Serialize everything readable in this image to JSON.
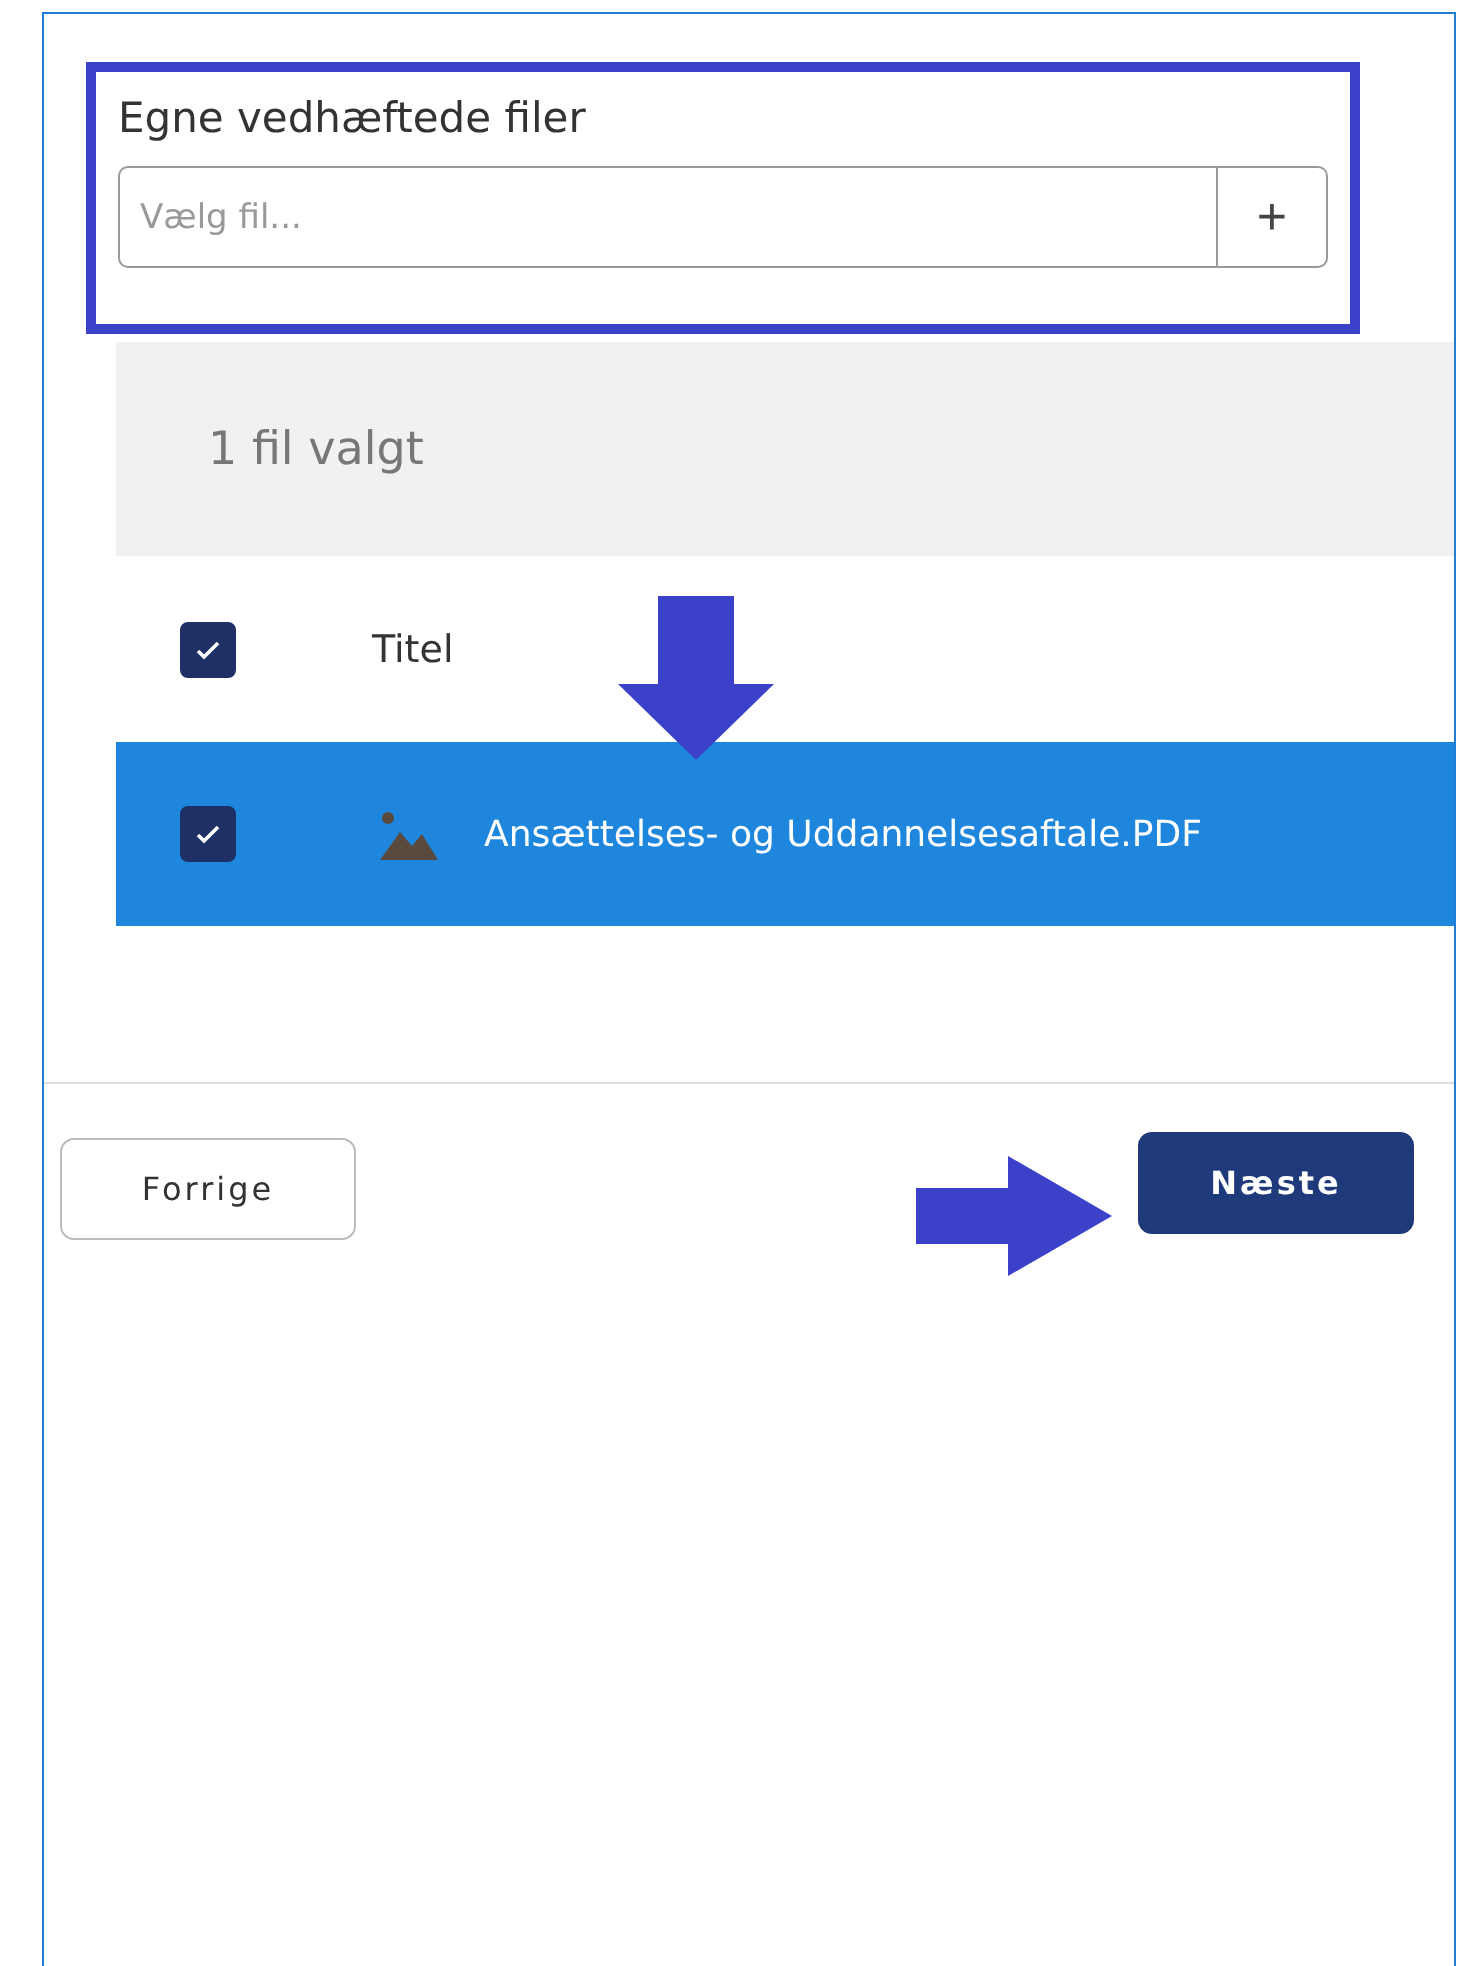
{
  "section": {
    "title": "Egne vedhæftede filer"
  },
  "file_input": {
    "placeholder": "Vælg fil...",
    "add_button": "+"
  },
  "selection_summary": "1 fil valgt",
  "table": {
    "header_checked": true,
    "columns": [
      {
        "label": "Titel"
      }
    ],
    "rows": [
      {
        "title": "Ansættelses- og Uddannelsesaftale.PDF",
        "selected": true,
        "checked": true
      }
    ]
  },
  "buttons": [
    {
      "label": "Forrige",
      "kind": "secondary"
    },
    {
      "label": "Næste",
      "kind": "primary"
    }
  ]
}
